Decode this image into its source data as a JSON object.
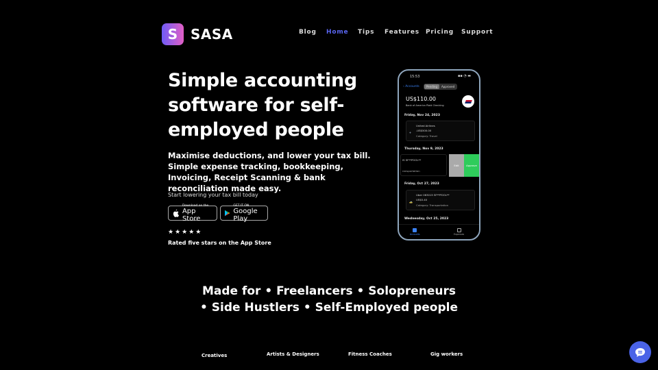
{
  "header": {
    "brand_letter": "S",
    "brand_name": "SASA",
    "nav": [
      "Blog",
      "Home",
      "Tips",
      "Features",
      "Pricing",
      "Support"
    ],
    "active_nav": "Home",
    "accent_color": "#5a66f1"
  },
  "hero": {
    "title": "Simple accounting software for  self-employed people",
    "subtitle": "Maximise deductions, and lower your tax bill. Simple expense tracking, bookkeeping, Invoicing, Receipt Scanning & bank reconciliation made easy.",
    "cta_text": "Start lowering your tax bill today",
    "app_store": {
      "small": "Download on the",
      "big": "App Store"
    },
    "google_play": {
      "small": "GET IT ON",
      "big": "Google Play"
    },
    "stars": "★★★★★",
    "rating": 5,
    "rated_text": "Rated five stars on the App Store"
  },
  "phone": {
    "time": "15:53",
    "signal": "▪▪ ◔ ▬",
    "back": "‹ Accounts",
    "segments": [
      "Pending",
      "Approved"
    ],
    "active_segment": "Pending",
    "amount": "US$110.00",
    "account": "Bank of America Plaid Checking",
    "transactions": [
      {
        "date": "Friday, Nov 24, 2023",
        "merchant": "United Airlines",
        "amount": "-US$500.00",
        "category": "Category: Travel"
      },
      {
        "date": "Thursday, Nov 9, 2023",
        "merchant": "IS SF**POOL**",
        "category": "ransportation",
        "edit": "Edit",
        "approve": "Approve"
      },
      {
        "date": "Friday, Oct 27, 2023",
        "merchant": "Uber 063015 SF**POOL**",
        "amount": "US$5.40",
        "category": "Category: Transportation"
      },
      {
        "date": "Wednesday, Oct 25, 2023"
      }
    ],
    "tabs": [
      "Accounts",
      "Expenses"
    ]
  },
  "made_for": {
    "line1": "Made for • Freelancers • Solopreneurs",
    "line2": "•  Side Hustlers • Self-Employed people"
  },
  "categories": [
    "Creatives",
    "Artists & Designers",
    "Fitness Coaches",
    "Gig workers"
  ],
  "chat": {
    "icon": "chat-icon",
    "color": "#4a63e7"
  }
}
